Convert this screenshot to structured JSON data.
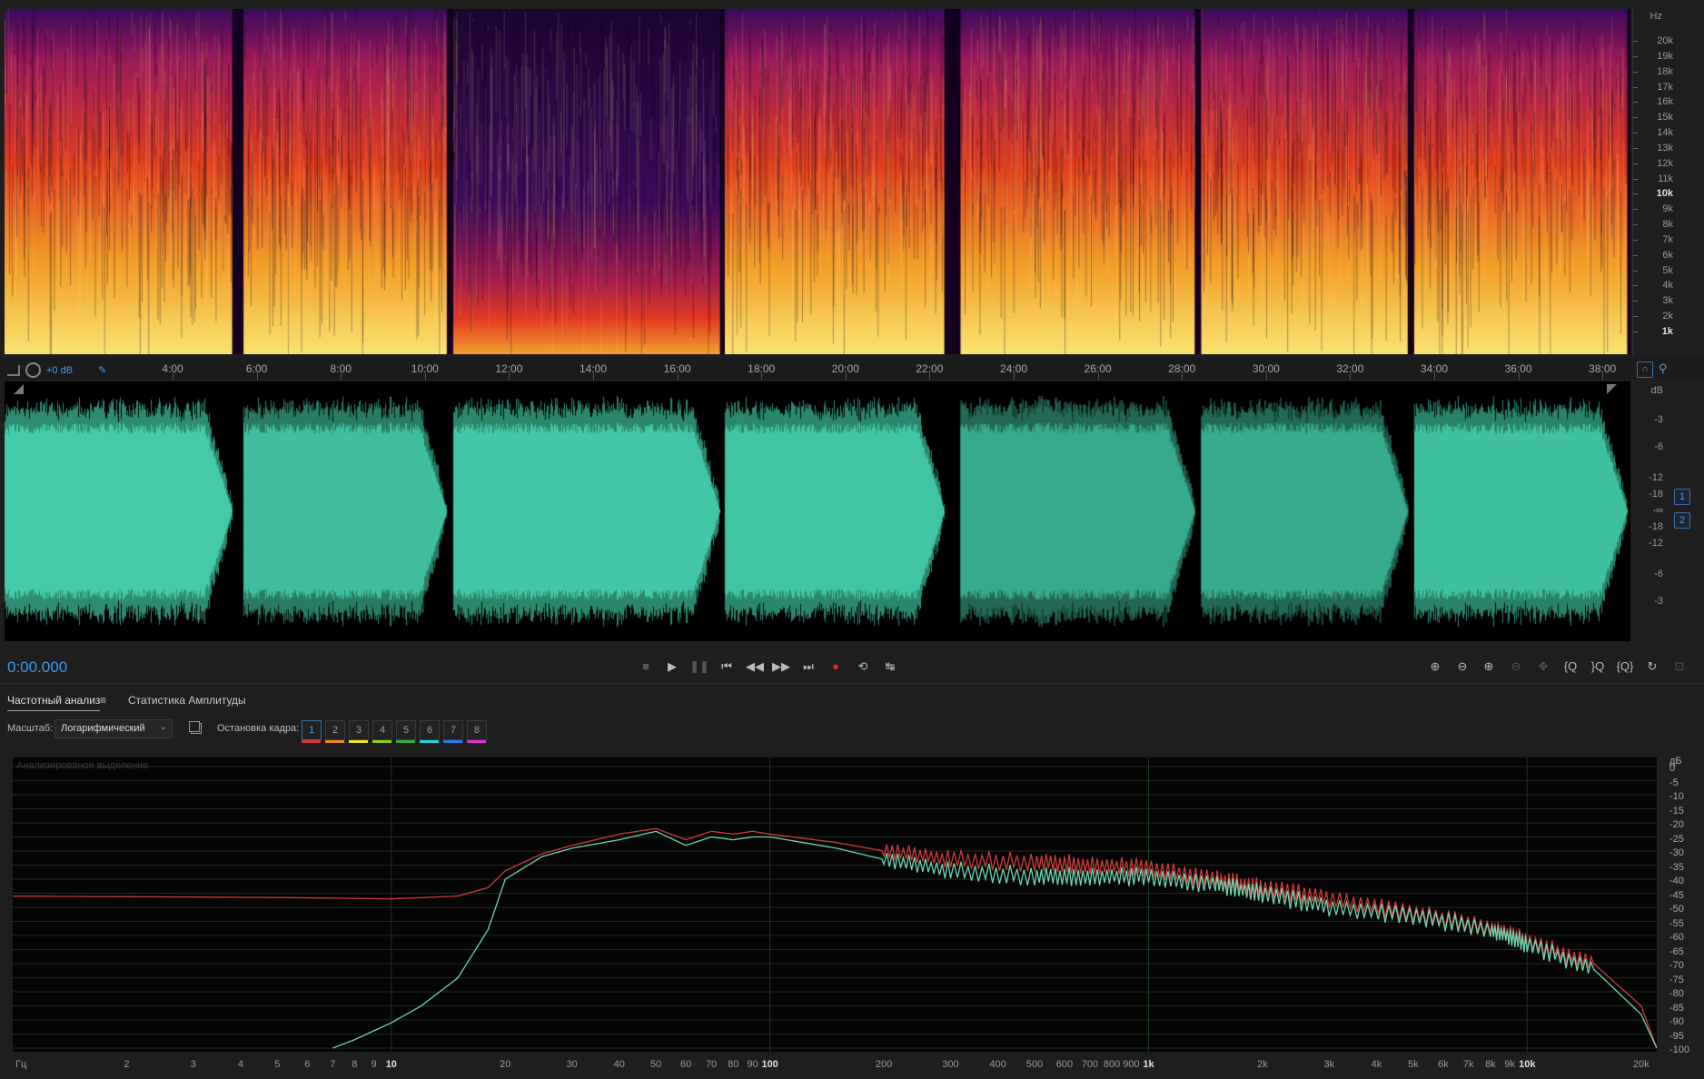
{
  "spectrogram": {
    "unit_label": "Hz",
    "freq_labels": [
      "20k",
      "19k",
      "18k",
      "17k",
      "16k",
      "15k",
      "14k",
      "13k",
      "12k",
      "11k",
      "10k",
      "9k",
      "8k",
      "7k",
      "6k",
      "5k",
      "4k",
      "3k",
      "2k",
      "1k"
    ],
    "tracks": [
      {
        "start": 0.0,
        "end": 0.14,
        "level": "hot"
      },
      {
        "start": 0.147,
        "end": 0.272,
        "level": "hot"
      },
      {
        "start": 0.276,
        "end": 0.44,
        "level": "cool"
      },
      {
        "start": 0.443,
        "end": 0.578,
        "level": "hot"
      },
      {
        "start": 0.588,
        "end": 0.732,
        "level": "hot"
      },
      {
        "start": 0.736,
        "end": 0.863,
        "level": "hot"
      },
      {
        "start": 0.867,
        "end": 0.998,
        "level": "hot"
      }
    ]
  },
  "ruler": {
    "gain": "+0 dB",
    "time_labels": [
      "4:00",
      "6:00",
      "8:00",
      "10:00",
      "12:00",
      "14:00",
      "16:00",
      "18:00",
      "20:00",
      "22:00",
      "24:00",
      "26:00",
      "28:00",
      "30:00",
      "32:00",
      "34:00",
      "36:00",
      "38:00"
    ]
  },
  "waveform": {
    "db_unit": "dB",
    "db_labels_top": [
      "-3",
      "-6",
      "-12",
      "-18"
    ],
    "inf_label": "-∞",
    "db_labels_bottom": [
      "-18",
      "-12",
      "-6",
      "-3"
    ],
    "channels": [
      "1",
      "2"
    ],
    "color": "#44c9a9"
  },
  "transport": {
    "timecode": "0:00.000"
  },
  "tabs": {
    "freq_analysis": "Частотный анализ",
    "amp_stats": "Статистика Амплитуды"
  },
  "options": {
    "scale_label": "Масштаб:",
    "scale_value": "Логарифмический",
    "freeze_label": "Остановка кадра:",
    "frames": [
      "1",
      "2",
      "3",
      "4",
      "5",
      "6",
      "7",
      "8"
    ],
    "frame_colors": [
      "#e03030",
      "#f08a20",
      "#f0e020",
      "#8ad020",
      "#30b040",
      "#20d0e0",
      "#2080f0",
      "#e030d0"
    ]
  },
  "chart_data": {
    "type": "line",
    "title": "Анализированое выделение",
    "xlabel": "Гц",
    "ylabel": "дБ",
    "x_scale": "log",
    "xlim": [
      1,
      22000
    ],
    "ylim": [
      -100,
      0
    ],
    "y_ticks": [
      0,
      -5,
      -10,
      -15,
      -20,
      -25,
      -30,
      -35,
      -40,
      -45,
      -50,
      -55,
      -60,
      -65,
      -70,
      -75,
      -80,
      -85,
      -90,
      -95,
      -100
    ],
    "x_tick_labels": [
      "2",
      "3",
      "4",
      "5",
      "6",
      "7",
      "8",
      "9",
      "10",
      "20",
      "30",
      "40",
      "50",
      "60",
      "70",
      "80",
      "90",
      "100",
      "200",
      "300",
      "400",
      "500",
      "600",
      "700",
      "800",
      "900",
      "1k",
      "2k",
      "3k",
      "4k",
      "5k",
      "6k",
      "7k",
      "8k",
      "9k",
      "10k",
      "20k"
    ],
    "series": [
      {
        "color": "#d03a3a",
        "x": [
          1,
          5,
          10,
          15,
          18,
          20,
          25,
          30,
          40,
          50,
          60,
          70,
          80,
          90,
          100,
          150,
          200,
          300,
          500,
          700,
          1000,
          1500,
          2000,
          3000,
          5000,
          8000,
          10000,
          15000,
          20000,
          22000
        ],
        "y": [
          -46,
          -46.5,
          -47,
          -46,
          -43,
          -37,
          -31,
          -28,
          -24,
          -22,
          -26,
          -23,
          -24,
          -23,
          -24,
          -27,
          -30,
          -33,
          -34,
          -35,
          -36,
          -40,
          -43,
          -47,
          -52,
          -57,
          -62,
          -70,
          -85,
          -100
        ]
      },
      {
        "color": "#6cd6b0",
        "x": [
          7,
          8,
          10,
          12,
          15,
          18,
          20,
          25,
          30,
          40,
          50,
          60,
          70,
          80,
          90,
          100,
          150,
          200,
          300,
          500,
          700,
          1000,
          1500,
          2000,
          3000,
          5000,
          8000,
          10000,
          15000,
          20000,
          22000
        ],
        "y": [
          -100,
          -97,
          -91,
          -85,
          -75,
          -58,
          -40,
          -32,
          -29,
          -26,
          -23,
          -28,
          -25,
          -26,
          -25,
          -25,
          -29,
          -33,
          -37,
          -39,
          -39,
          -39,
          -42,
          -45,
          -50,
          -53,
          -58,
          -63,
          -72,
          -88,
          -100
        ]
      }
    ]
  }
}
